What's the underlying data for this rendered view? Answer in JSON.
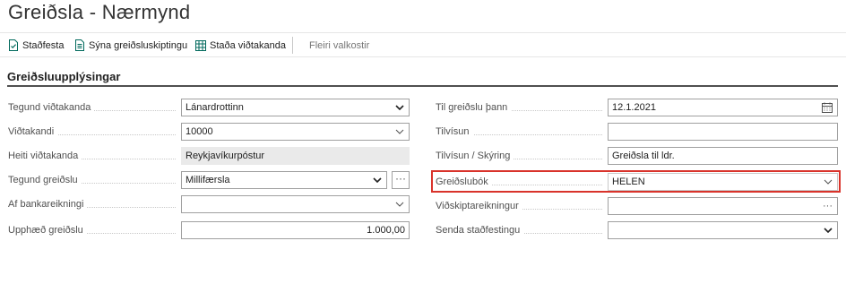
{
  "page": {
    "title": "Greiðsla - Nærmynd"
  },
  "toolbar": {
    "confirm_label": "Staðfesta",
    "show_split_label": "Sýna greiðsluskiptingu",
    "recipient_status_label": "Staða viðtakanda",
    "more_options_label": "Fleiri valkostir"
  },
  "section": {
    "title": "Greiðsluupplýsingar"
  },
  "left_fields": [
    {
      "label": "Tegund viðtakanda",
      "value": "Lánardrottinn",
      "control": "select"
    },
    {
      "label": "Viðtakandi",
      "value": "10000",
      "control": "dropdown"
    },
    {
      "label": "Heiti viðtakanda",
      "value": "Reykjavíkurpóstur",
      "control": "readonly"
    },
    {
      "label": "Tegund greiðslu",
      "value": "Millifærsla",
      "control": "select"
    },
    {
      "label": "Af bankareikningi",
      "value": "",
      "control": "dropdown"
    },
    {
      "label": "Upphæð greiðslu",
      "value": "1.000,00",
      "control": "number"
    }
  ],
  "right_fields": [
    {
      "label": "Til greiðslu þann",
      "value": "12.1.2021",
      "control": "date"
    },
    {
      "label": "Tilvísun",
      "value": "",
      "control": "text"
    },
    {
      "label": "Tilvísun / Skýring",
      "value": "Greiðsla til ldr.",
      "control": "text"
    },
    {
      "label": "Greiðslubók",
      "value": "HELEN",
      "control": "dropdown"
    },
    {
      "label": "Viðskiptareikningur",
      "value": "",
      "control": "lookup"
    },
    {
      "label": "Senda staðfestingu",
      "value": "",
      "control": "select"
    }
  ],
  "colors": {
    "highlight": "#d9332b",
    "accent": "#00695c"
  },
  "icons": {
    "confirm": "document-check-icon",
    "show_split": "document-split-icon",
    "recipient_status": "grid-icon"
  }
}
